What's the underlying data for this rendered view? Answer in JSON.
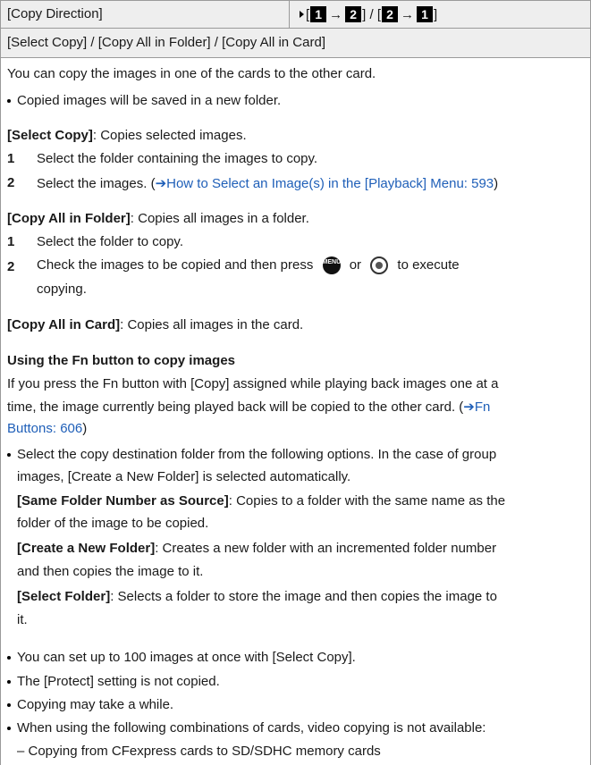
{
  "header": {
    "setting_name": "[Copy Direction]",
    "options": {
      "prefix": "[",
      "opt1_from": "1",
      "opt1_to": "2",
      "sep": "] / [",
      "opt2_from": "2",
      "opt2_to": "1",
      "suffix": "]",
      "arrow": "→"
    }
  },
  "subheader": "[Select Copy] / [Copy All in Folder] / [Copy All in Card]",
  "intro": "You can copy the images in one of the cards to the other card.",
  "intro_bullet": "Copied images will be saved in a new folder.",
  "select_copy": {
    "label": "[Select Copy]",
    "desc": ": Copies selected images.",
    "steps": [
      {
        "num": "1",
        "text": "Select the folder containing the images to copy."
      },
      {
        "num": "2",
        "text": "Select the images. (",
        "link": "➔How to Select an Image(s) in the [Playback] Menu: 593",
        "after": ")"
      }
    ]
  },
  "copy_all_folder": {
    "label": "[Copy All in Folder]",
    "desc": ": Copies all images in a folder.",
    "steps": [
      {
        "num": "1",
        "text": "Select the folder to copy."
      },
      {
        "num": "2",
        "text_a": "Check the images to be copied and then press",
        "or": "or",
        "text_b": "to execute",
        "text_c": "copying."
      }
    ],
    "menu_icon_text_top": "MENU",
    "menu_icon_text_bottom": "/SET"
  },
  "copy_all_card": {
    "label": "[Copy All in Card]",
    "desc": ": Copies all images in the card."
  },
  "fn_section": {
    "heading": "Using the Fn button to copy images",
    "line1": "If you press the Fn button with [Copy] assigned while playing back images one at a",
    "line2": "time, the image currently being played back will be copied to the other card. (",
    "line2_link": "➔Fn",
    "line3_link": "Buttons: 606",
    "line3_after": ")",
    "bullet_l1": "Select the copy destination folder from the following options. In the case of group",
    "bullet_l2": "images, [Create a New Folder] is selected automatically.",
    "opt1_label": "[Same Folder Number as Source]",
    "opt1_l1": ": Copies to a folder with the same name as the",
    "opt1_l2": "folder of the image to be copied.",
    "opt2_label": "[Create a New Folder]",
    "opt2_l1": ": Creates a new folder with an incremented folder number",
    "opt2_l2": "and then copies the image to it.",
    "opt3_label": "[Select Folder]",
    "opt3_l1": ": Selects a folder to store the image and then copies the image to",
    "opt3_l2": "it."
  },
  "notes": [
    "You can set up to 100 images at once with [Select Copy].",
    "The [Protect] setting is not copied.",
    "Copying may take a while.",
    "When using the following combinations of cards, video copying is not available:"
  ],
  "sub_note": "– Copying from CFexpress cards to SD/SDHC memory cards"
}
